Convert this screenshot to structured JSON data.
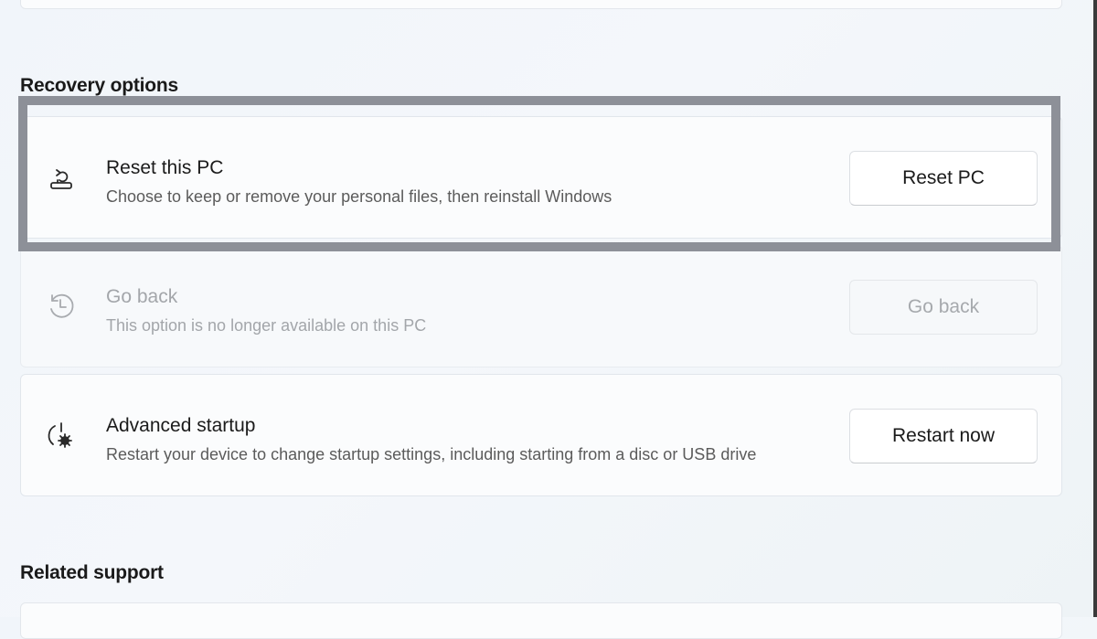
{
  "sections": {
    "recovery_title": "Recovery options",
    "related_title": "Related support"
  },
  "options": {
    "reset": {
      "title": "Reset this PC",
      "description": "Choose to keep or remove your personal files, then reinstall Windows",
      "button_label": "Reset PC",
      "icon": "reset-pc-icon"
    },
    "goback": {
      "title": "Go back",
      "description": "This option is no longer available on this PC",
      "button_label": "Go back",
      "icon": "history-icon",
      "disabled": true
    },
    "advanced": {
      "title": "Advanced startup",
      "description": "Restart your device to change startup settings, including starting from a disc or USB drive",
      "button_label": "Restart now",
      "icon": "advanced-startup-icon"
    }
  },
  "colors": {
    "highlight_border": "#8d9098",
    "disabled_text": "#a3a6aa",
    "secondary_text": "#5b5b5b"
  }
}
